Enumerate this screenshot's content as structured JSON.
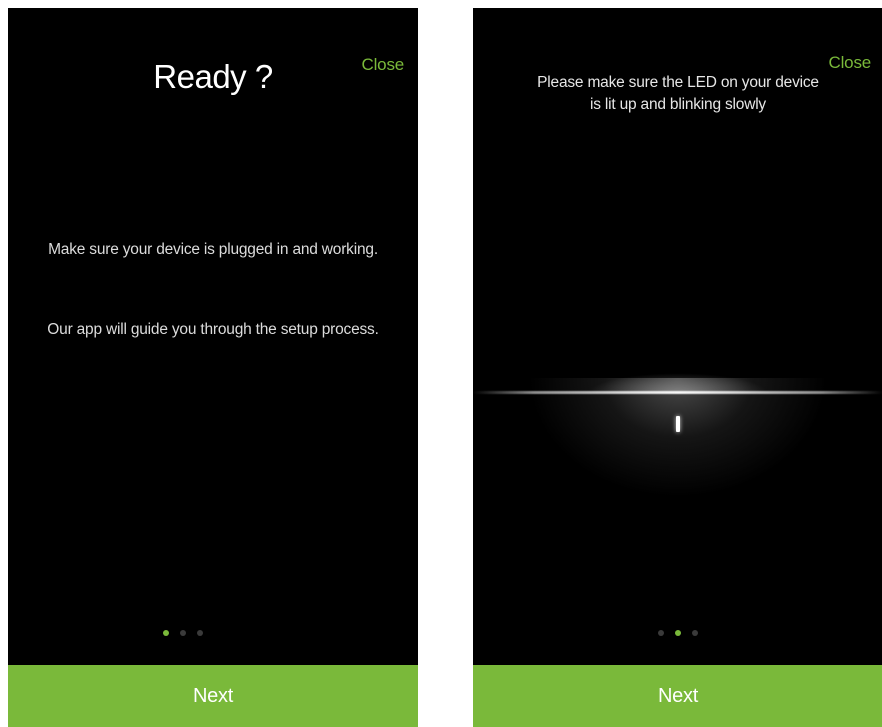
{
  "theme": {
    "accent": "#7ab93a",
    "background": "#000000"
  },
  "screens": [
    {
      "close_label": "Close",
      "title": "Ready ?",
      "paragraphs": [
        "Make sure your device is plugged in and working.",
        "Our app will guide you through the setup process."
      ],
      "pagination": {
        "total": 3,
        "active": 1
      },
      "next_label": "Next"
    },
    {
      "close_label": "Close",
      "instruction": "Please make sure the LED on your device is lit up and blinking slowly",
      "pagination": {
        "total": 3,
        "active": 2
      },
      "next_label": "Next"
    }
  ]
}
